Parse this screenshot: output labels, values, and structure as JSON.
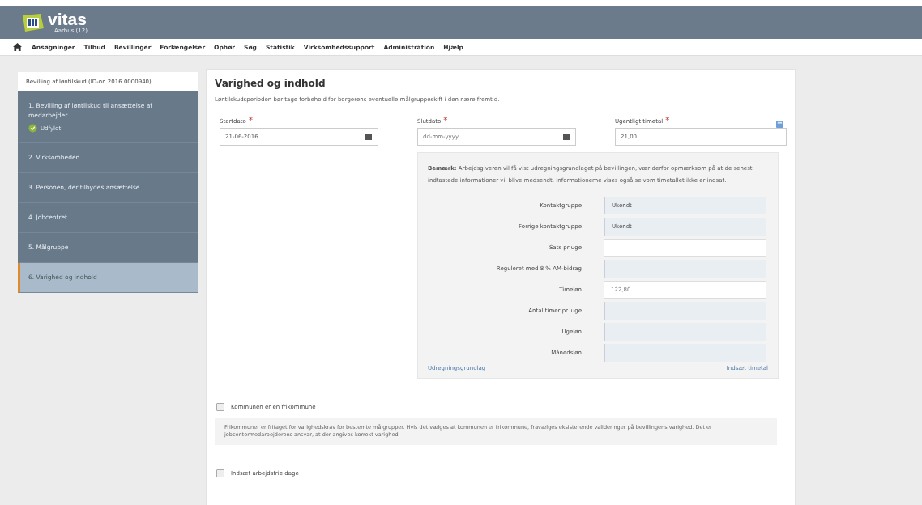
{
  "header": {
    "logo": "vitas",
    "subtitle": "Aarhus (12)"
  },
  "nav": [
    "Ansøgninger",
    "Tilbud",
    "Bevillinger",
    "Forlængelser",
    "Ophør",
    "Søg",
    "Statistik",
    "Virksomhedssupport",
    "Administration",
    "Hjælp"
  ],
  "sidebar": {
    "title": "Bevilling af løntilskud (ID-nr. 2016.0000940)",
    "steps": [
      {
        "label": "1. Bevilling af løntilskud til ansættelse af medarbejder",
        "status": "Udfyldt",
        "selected": false
      },
      {
        "label": "2. Virksomheden",
        "selected": false
      },
      {
        "label": "3. Personen, der tilbydes ansættelse",
        "selected": false
      },
      {
        "label": "4. Jobcentret",
        "selected": false
      },
      {
        "label": "5. Målgruppe",
        "selected": false
      },
      {
        "label": "6. Varighed og indhold",
        "selected": true
      }
    ]
  },
  "required_mark": "*",
  "main": {
    "title": "Varighed og indhold",
    "intro": "Løntilskudsperioden bør tage forbehold for borgerens eventuelle målgruppeskift i den nære fremtid.",
    "fields": [
      {
        "label": "Startdato",
        "required": true,
        "kind": "date",
        "value": "21-06-2016"
      },
      {
        "label": "Slutdato",
        "required": true,
        "kind": "date",
        "placeholder": "dd-mm-yyyy"
      },
      {
        "label": "Ugentligt timetal",
        "required": true,
        "kind": "text",
        "value": "21,00"
      }
    ],
    "note": "**Bemærk:** Arbejdsgiveren vil få vist udregningsgrundlaget på bevillingen, vær derfor opmærksom på at de senest indtastede informationer vil blive medsendt. Informationerne vises også selvom timetallet ikke er indsat.",
    "calc_rows": [
      {
        "label": "Kontaktgruppe",
        "kind": "readonly",
        "value": "Ukendt"
      },
      {
        "label": "Forrige kontaktgruppe",
        "kind": "readonly",
        "value": "Ukendt"
      },
      {
        "label": "Sats pr uge",
        "kind": "input"
      },
      {
        "label": "Reguleret med 8 % AM-bidrag",
        "kind": "readonly"
      },
      {
        "label": "Timeløn",
        "kind": "input",
        "value": "122,80"
      },
      {
        "label": "Antal timer pr. uge",
        "kind": "readonly"
      },
      {
        "label": "Ugeløn",
        "kind": "readonly"
      },
      {
        "label": "Månedsløn",
        "kind": "readonly"
      }
    ],
    "links": [
      "Udregningsgrundlag",
      "Indsæt timetal"
    ],
    "checkboxes": [
      {
        "label": "Kommunen er en frikommune",
        "checked": false,
        "help": "Frikommuner er fritaget for varighedskrav for bestemte målgrupper. Hvis det vælges at kommunen er frikommune, fravælges eksisterende valideringer på bevillingens varighed. Det er jobcentermedarbejderens ansvar, at der angives korrekt varighed."
      },
      {
        "label": "Indsæt arbejdsfrie dage",
        "checked": false
      }
    ]
  }
}
